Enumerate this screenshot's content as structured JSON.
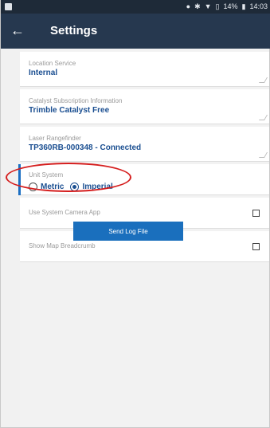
{
  "status_bar": {
    "battery": "14%",
    "time": "14:03"
  },
  "app_bar": {
    "back_glyph": "←",
    "title": "Settings"
  },
  "settings": {
    "location_service": {
      "label": "Location Service",
      "value": "Internal"
    },
    "subscription": {
      "label": "Catalyst Subscription Information",
      "value": "Trimble Catalyst Free"
    },
    "rangefinder": {
      "label": "Laser Rangefinder",
      "value": "TP360RB-000348 - Connected"
    },
    "unit_system": {
      "label": "Unit System",
      "options": [
        "Metric",
        "Imperial"
      ],
      "selected": "Imperial"
    },
    "camera_app": {
      "label": "Use System Camera App",
      "checked": false
    },
    "breadcrumb": {
      "label": "Show Map Breadcrumb",
      "checked": false
    }
  },
  "actions": {
    "send_log": "Send Log File"
  },
  "colors": {
    "app_bar": "#26384f",
    "status_bar": "#1e2a38",
    "accent": "#1b4f91",
    "button": "#1a6fbd",
    "annotation": "#d51e1e"
  }
}
